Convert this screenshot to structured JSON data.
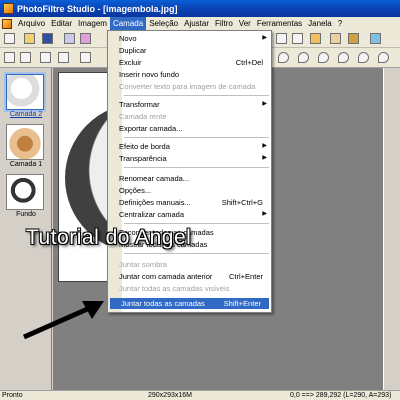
{
  "title": "PhotoFiltre Studio - [imagembola.jpg]",
  "menubar": [
    "Arquivo",
    "Editar",
    "Imagem",
    "Camada",
    "Seleção",
    "Ajustar",
    "Filtro",
    "Ver",
    "Ferramentas",
    "Janela",
    "?"
  ],
  "active_menu": "Camada",
  "layers": [
    {
      "label": "Camada 2"
    },
    {
      "label": "Camada 1"
    },
    {
      "label": "Fundo"
    }
  ],
  "menu_items": [
    {
      "label": "Novo",
      "shortcut": "",
      "arrow": "▶",
      "disabled": false
    },
    {
      "label": "Duplicar",
      "shortcut": "",
      "arrow": "",
      "disabled": false
    },
    {
      "label": "Excluir",
      "shortcut": "Ctrl+Del",
      "arrow": "",
      "disabled": false
    },
    {
      "label": "Inserir novo fundo",
      "shortcut": "",
      "arrow": "",
      "disabled": false
    },
    {
      "label": "Converter texto para imagem de camada",
      "shortcut": "",
      "arrow": "",
      "disabled": true
    },
    {
      "label": "Transformar",
      "shortcut": "",
      "arrow": "▶",
      "disabled": false
    },
    {
      "label": "Camada rente",
      "shortcut": "",
      "arrow": "",
      "disabled": true
    },
    {
      "label": "Exportar camada...",
      "shortcut": "",
      "arrow": "",
      "disabled": false
    },
    {
      "label": "Efeito de borda",
      "shortcut": "",
      "arrow": "▶",
      "disabled": false
    },
    {
      "label": "Transparência",
      "shortcut": "",
      "arrow": "▶",
      "disabled": false
    },
    {
      "label": "Renomear camada...",
      "shortcut": "",
      "arrow": "",
      "disabled": false
    },
    {
      "label": "Opções...",
      "shortcut": "",
      "arrow": "",
      "disabled": false
    },
    {
      "label": "Definições manuais...",
      "shortcut": "Shift+Ctrl+G",
      "arrow": "",
      "disabled": false
    },
    {
      "label": "Centralizar camada",
      "shortcut": "",
      "arrow": "▶",
      "disabled": false
    },
    {
      "label": "Esconder todas as camadas",
      "shortcut": "",
      "arrow": "",
      "disabled": false
    },
    {
      "label": "Mostrar todas as camadas",
      "shortcut": "",
      "arrow": "",
      "disabled": false
    },
    {
      "label": "Juntar sombra",
      "shortcut": "",
      "arrow": "",
      "disabled": true
    },
    {
      "label": "Juntar com camada anterior",
      "shortcut": "Ctrl+Enter",
      "arrow": "",
      "disabled": false
    },
    {
      "label": "Juntar todas as camadas visíveis",
      "shortcut": "",
      "arrow": "",
      "disabled": true
    },
    {
      "label": "Juntar todas as camadas",
      "shortcut": "Shift+Enter",
      "arrow": "",
      "disabled": false,
      "highlighted": true
    }
  ],
  "status": {
    "left": "Pronto",
    "middle": "290x293x16M",
    "right": "0,0 ==> 289,292 (L=290, A=293)"
  },
  "watermark": "Tutorial do Angel",
  "colors": {
    "titlebar": "#0b3fb0",
    "highlight": "#316ac5"
  }
}
